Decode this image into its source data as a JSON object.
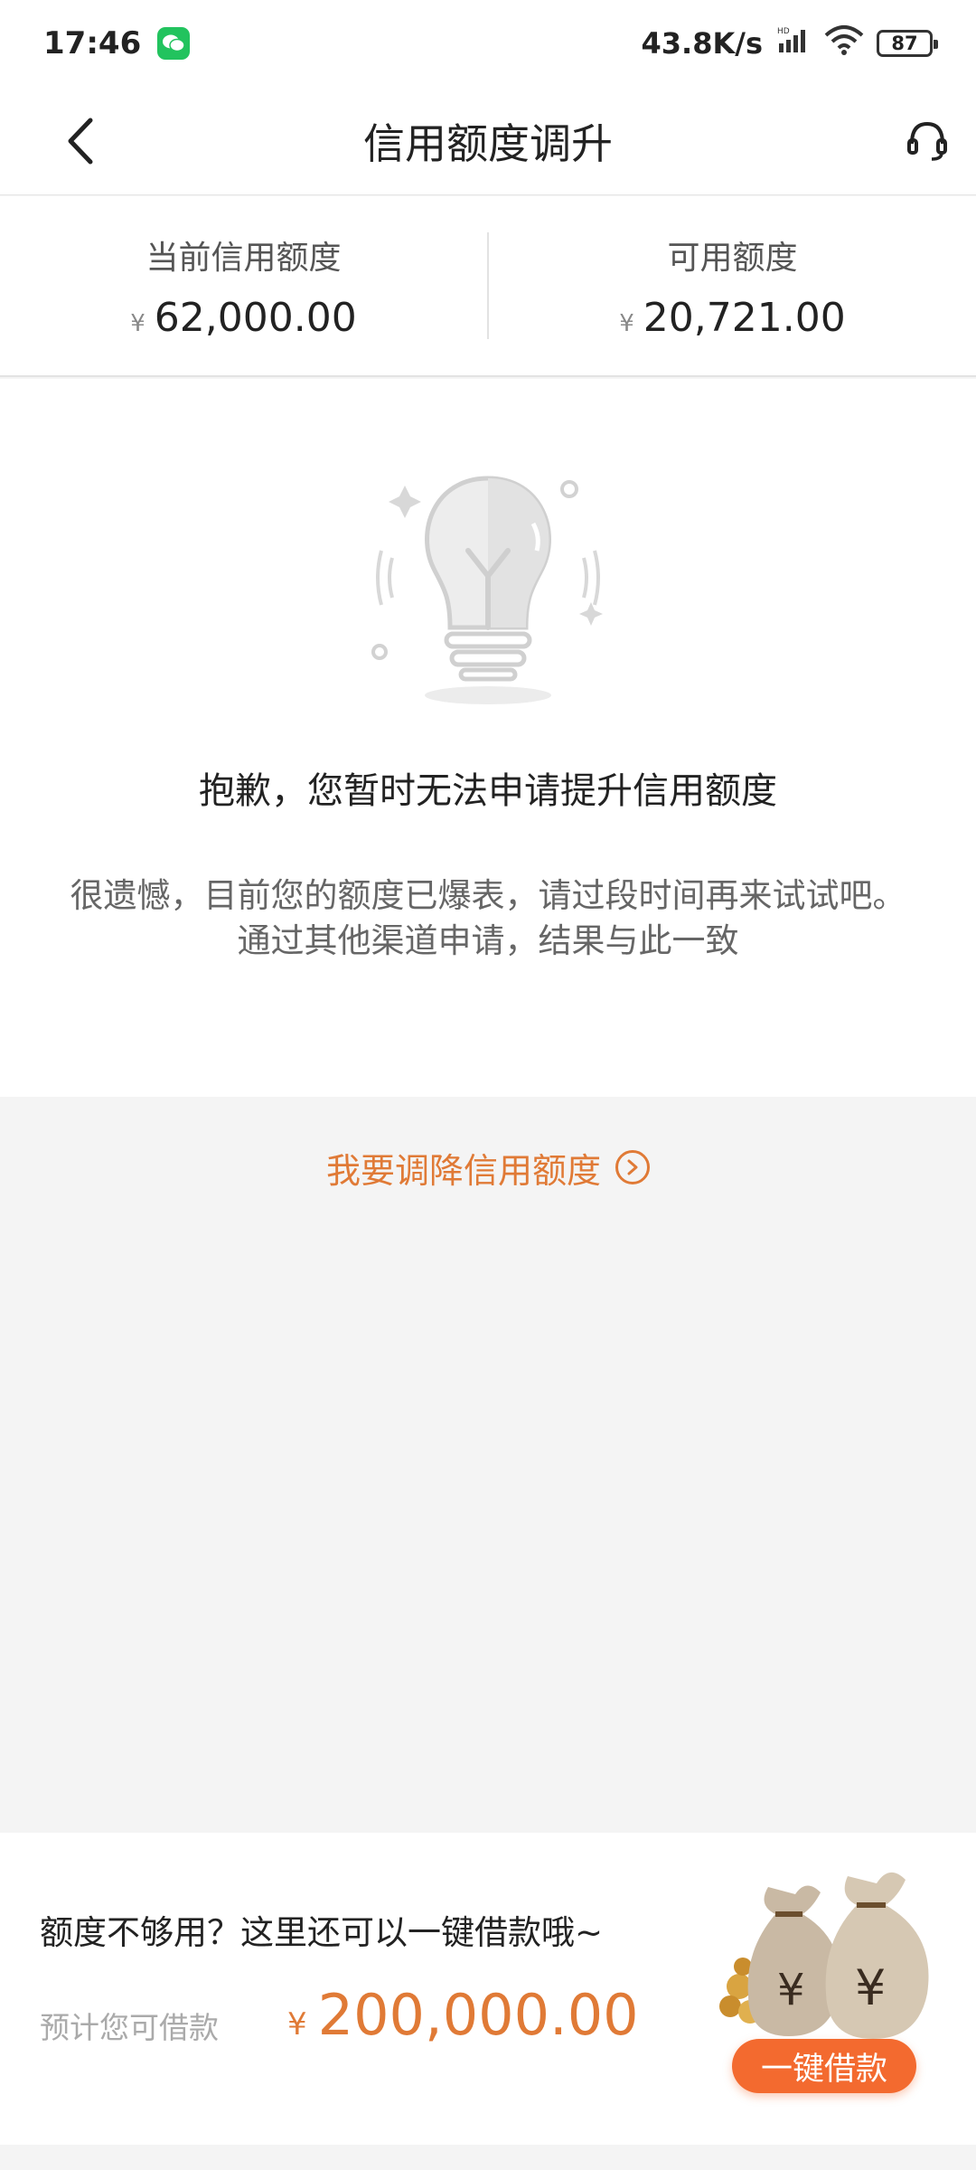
{
  "status_bar": {
    "time": "17:46",
    "net_speed": "43.8K/s",
    "battery": "87",
    "icons": [
      "wechat-icon",
      "signal-icon",
      "wifi-icon",
      "battery-icon"
    ]
  },
  "header": {
    "title": "信用额度调升",
    "back_icon": "chevron-left-icon",
    "support_icon": "headset-icon"
  },
  "limits": {
    "current_label": "当前信用额度",
    "current_currency": "¥",
    "current_value": "62,000.00",
    "available_label": "可用额度",
    "available_currency": "¥",
    "available_value": "20,721.00"
  },
  "notice": {
    "illustration_icon": "lightbulb-icon",
    "title": "抱歉，您暂时无法申请提升信用额度",
    "desc_line1": "很遗憾，目前您的额度已爆表，请过段时间再来试试吧。",
    "desc_line2": "通过其他渠道申请，结果与此一致"
  },
  "reduce_link": {
    "label": "我要调降信用额度",
    "icon": "chevron-right-circle-icon"
  },
  "loan": {
    "prompt": "额度不够用？这里还可以一键借款哦~",
    "estimate_label": "预计您可借款",
    "currency": "¥",
    "amount": "200,000.00",
    "button_label": "一键借款",
    "illustration_icon": "money-bags-icon"
  },
  "colors": {
    "accent_orange": "#e07a36",
    "button_orange": "#f36a2f",
    "background": "#f4f4f4",
    "wechat_green": "#22c35e"
  }
}
